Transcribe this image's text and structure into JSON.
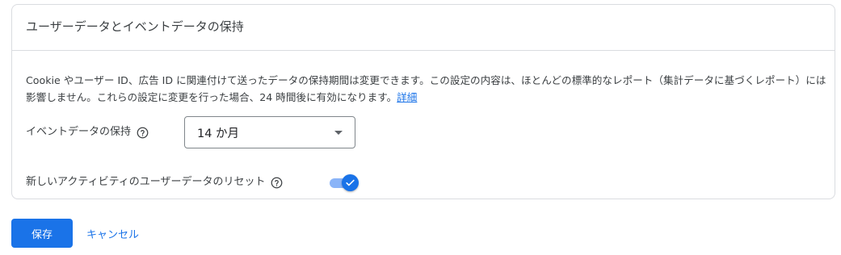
{
  "card": {
    "title": "ユーザーデータとイベントデータの保持"
  },
  "description": {
    "text": "Cookie やユーザー ID、広告 ID に関連付けて送ったデータの保持期間は変更できます。この設定の内容は、ほとんどの標準的なレポート（集計データに基づくレポート）には影響しません。これらの設定に変更を行った場合、24 時間後に有効になります。",
    "link_label": "詳細"
  },
  "event_retention": {
    "label": "イベントデータの保持",
    "help_icon": "help-circle-icon",
    "selected_value": "14 か月"
  },
  "reset_on_activity": {
    "label": "新しいアクティビティのユーザーデータのリセット",
    "help_icon": "help-circle-icon",
    "enabled": true
  },
  "footer": {
    "save_label": "保存",
    "cancel_label": "キャンセル"
  },
  "colors": {
    "accent": "#1a73e8",
    "toggle_track": "#8ab4f8",
    "border": "#dadce0",
    "text": "#3c4043"
  }
}
